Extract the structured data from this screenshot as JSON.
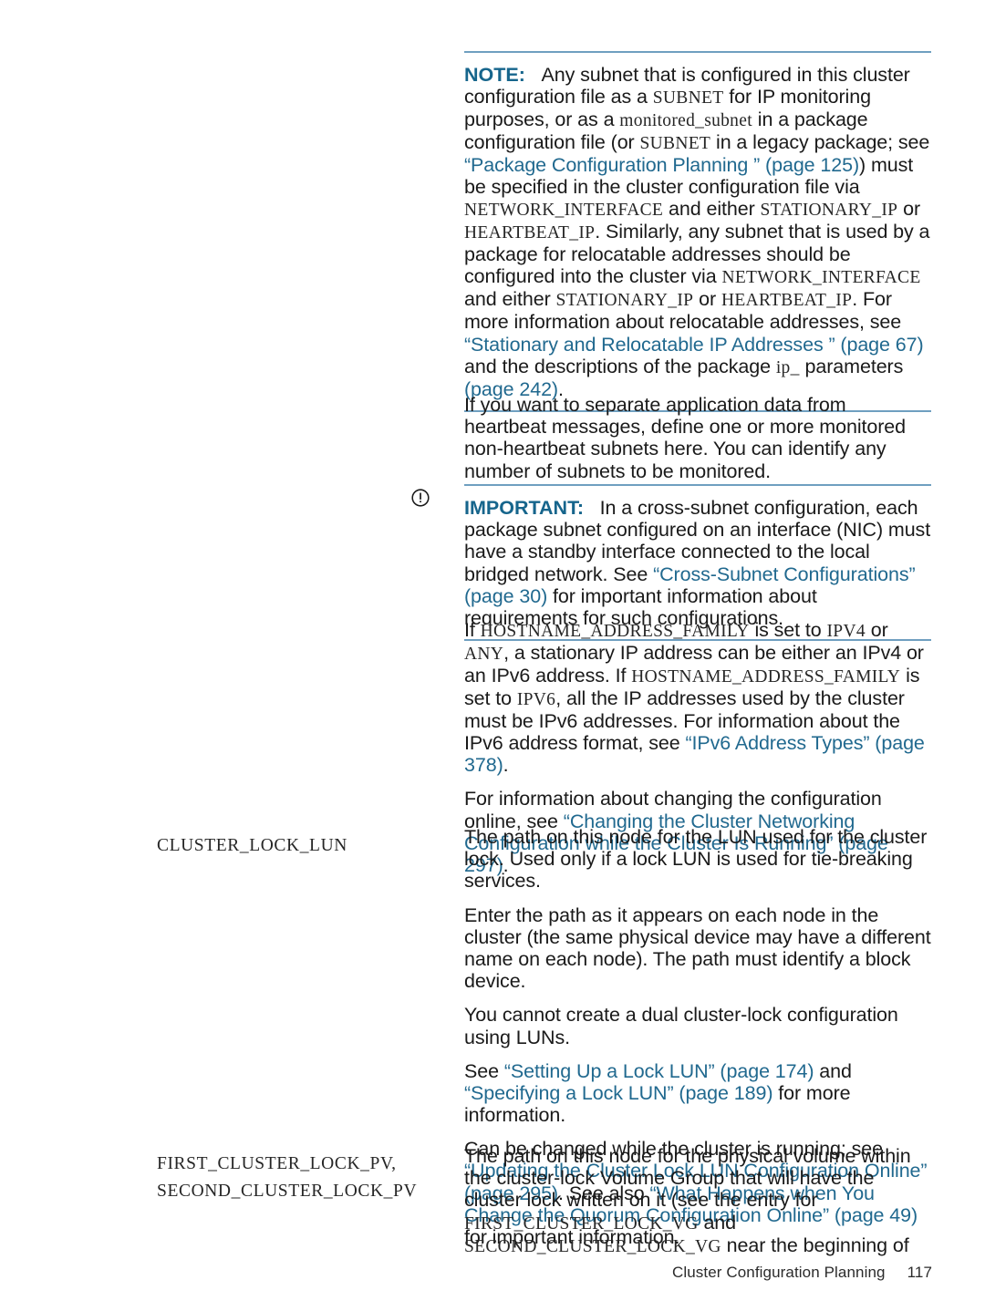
{
  "document": {
    "footer": {
      "chapter_title": "Cluster Configuration Planning",
      "page_number": "117"
    },
    "colors": {
      "link": "#21698f",
      "admonition_label": "#16658c",
      "rule": "#6f9fc0",
      "body_text": "#1a1a1a"
    }
  },
  "blocks": {
    "note": {
      "label": "NOTE:",
      "p1_a": "Any subnet that is configured in this cluster configuration file as a ",
      "p1_code1": "SUBNET",
      "p1_b": " for IP monitoring purposes, or as a ",
      "p1_code2": "monitored_subnet",
      "p1_c": " in a package configuration file (or ",
      "p1_code3": "SUBNET",
      "p1_d": " in a legacy package; see ",
      "p1_link1": "“Package Configuration Planning ” (page 125)",
      "p1_e": ") must be specified in the cluster configuration file via ",
      "p1_code4": "NETWORK_INTERFACE",
      "p1_f": " and either ",
      "p1_code5": "STATIONARY_IP",
      "p1_g": " or ",
      "p1_code6": "HEARTBEAT_IP",
      "p1_h": ". Similarly, any subnet that is used by a package for relocatable addresses should be configured into the cluster via ",
      "p1_code7": "NETWORK_INTERFACE",
      "p1_i": " and either ",
      "p1_code8": "STATIONARY_IP",
      "p1_j": " or ",
      "p1_code9": "HEARTBEAT_IP",
      "p1_k": ". For more information about relocatable addresses, see ",
      "p1_link2": "“Stationary and Relocatable IP Addresses ” (page 67)",
      "p1_l": " and the descriptions of the package ",
      "p1_code10": "ip_",
      "p1_m": " parameters ",
      "p1_link3": "(page 242)",
      "p1_n": "."
    },
    "monitored_subnets": {
      "p1": "If you want to separate application data from heartbeat messages, define one or more monitored non-heartbeat subnets here. You can identify any number of subnets to be monitored."
    },
    "important": {
      "icon": "exclamation-circle-icon",
      "label": "IMPORTANT:",
      "p1_a": "In a cross-subnet configuration, each package subnet configured on an interface (NIC) must have a standby interface connected to the local bridged network. See ",
      "p1_link": "“Cross-Subnet Configurations” (page 30)",
      "p1_b": " for important information about requirements for such configurations."
    },
    "hostname_family": {
      "p1_a": "If ",
      "p1_code1": "HOSTNAME_ADDRESS_FAMILY",
      "p1_b": " is set to ",
      "p1_code2": "IPV4",
      "p1_c": " or ",
      "p1_code3": "ANY",
      "p1_d": ", a stationary IP address can be either an IPv4 or an IPv6 address. If ",
      "p1_code4": "HOSTNAME_ADDRESS_FAMILY",
      "p1_e": " is set to ",
      "p1_code5": "IPV6",
      "p1_f": ", all the IP addresses used by the cluster must be IPv6 addresses. For information about the IPv6 address format, see ",
      "p1_link": "“IPv6 Address Types” (page 378)",
      "p1_g": ".",
      "p2_a": "For information about changing the configuration online, see ",
      "p2_link": "“Changing the Cluster Networking Configuration while the Cluster Is Running” (page 297)",
      "p2_b": "."
    },
    "cluster_lock_lun": {
      "param_name": "CLUSTER_LOCK_LUN",
      "p1": "The path on this node for the LUN used for the cluster lock. Used only if a lock LUN is used for tie-breaking services.",
      "p2": "Enter the path as it appears on each node in the cluster (the same physical device may have a different name on each node). The path must identify a block device.",
      "p3": "You cannot create a dual cluster-lock configuration using LUNs.",
      "p4_a": "See ",
      "p4_link1": "“Setting Up a Lock LUN” (page 174)",
      "p4_b": " and ",
      "p4_link2": "“Specifying a Lock LUN” (page 189)",
      "p4_c": " for more information.",
      "p5_a": "Can be changed while the cluster is running; see ",
      "p5_link1": "“Updating the Cluster Lock LUN Configuration Online” (page 295)",
      "p5_b": ". See also ",
      "p5_link2": "“What Happens when You Change the Quorum Configuration Online” (page 49)",
      "p5_c": " for important information."
    },
    "cluster_lock_pv": {
      "param_name_line1": "FIRST_CLUSTER_LOCK_PV,",
      "param_name_line2": "SECOND_CLUSTER_LOCK_PV",
      "p1_a": "The path on this node for the physical volume within the cluster-lock Volume Group that will have the cluster lock written on it (see the entry for ",
      "p1_code1": "FIRST_CLUSTER_LOCK_VG",
      "p1_b": " and ",
      "p1_code2": "SECOND_CLUSTER_LOCK_VG",
      "p1_c": " near the beginning of"
    }
  }
}
